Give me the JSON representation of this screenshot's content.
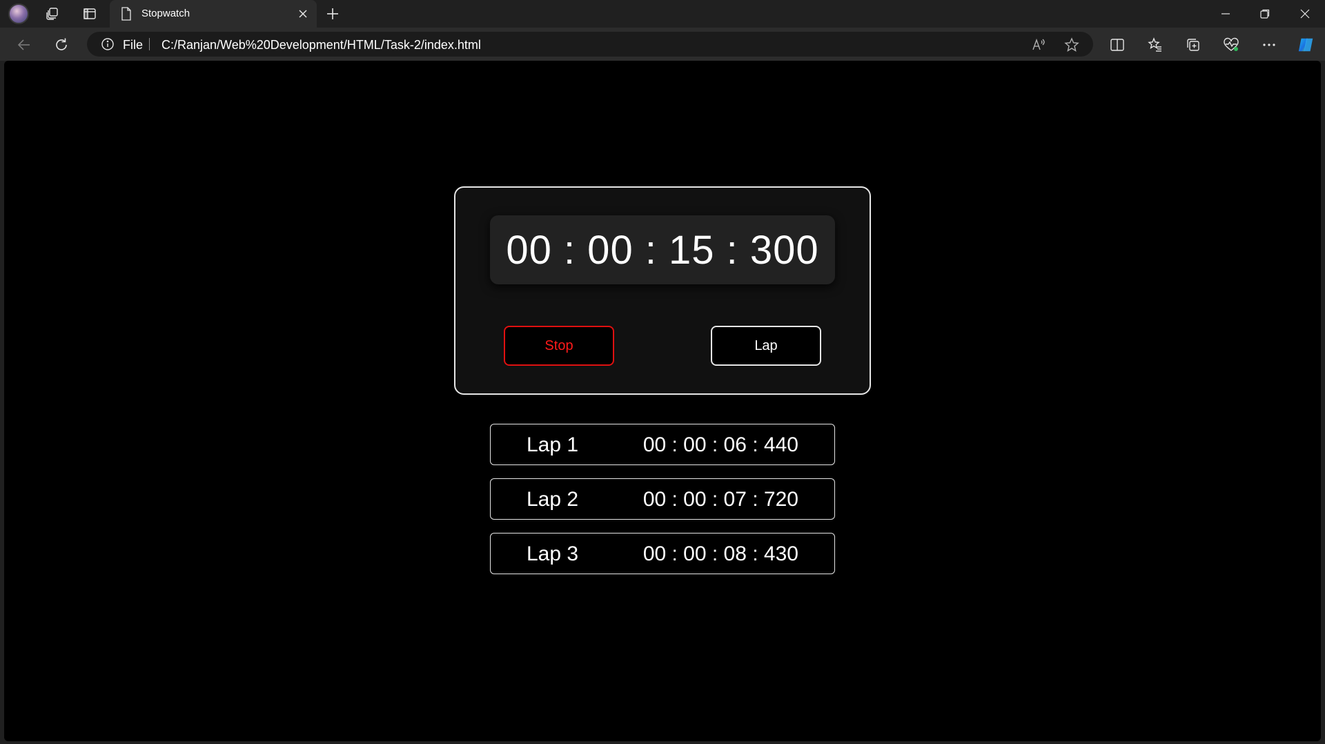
{
  "browser": {
    "tab_title": "Stopwatch",
    "address_scheme_label": "File",
    "address_url": "C:/Ranjan/Web%20Development/HTML/Task-2/index.html"
  },
  "stopwatch": {
    "display": "00 : 00 : 15 : 300",
    "stop_label": "Stop",
    "lap_label": "Lap",
    "stop_color": "#ff1a1a"
  },
  "laps": [
    {
      "name": "Lap 1",
      "time": "00 : 00 : 06 : 440"
    },
    {
      "name": "Lap 2",
      "time": "00 : 00 : 07 : 720"
    },
    {
      "name": "Lap 3",
      "time": "00 : 00 : 08 : 430"
    }
  ],
  "icons": {
    "workspaces": "workspaces-icon",
    "tab_actions": "tab-actions-icon",
    "read_aloud": "read-aloud-icon",
    "favorite": "star-icon",
    "split_screen": "split-screen-icon",
    "favorites": "favorites-icon",
    "collections": "collections-icon",
    "browser_essentials": "heartbeat-icon",
    "more": "more-icon",
    "copilot": "copilot-icon"
  }
}
